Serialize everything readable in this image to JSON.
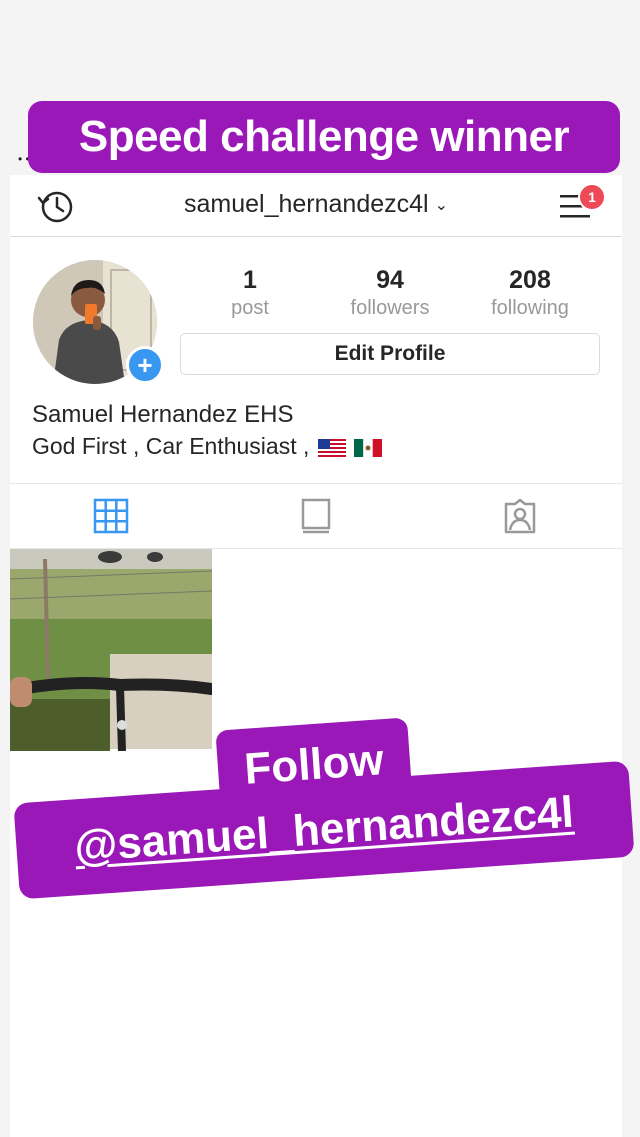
{
  "story_top_banner": "Speed challenge winner",
  "header": {
    "username": "samuel_hernandezc4l",
    "notification_count": "1"
  },
  "stats": [
    {
      "value": "1",
      "label": "post"
    },
    {
      "value": "94",
      "label": "followers"
    },
    {
      "value": "208",
      "label": "following"
    }
  ],
  "edit_profile_label": "Edit Profile",
  "profile": {
    "full_name": "Samuel Hernandez EHS",
    "bio": "God First , Car Enthusiast ,"
  },
  "follow_sticker": {
    "line1": "Follow",
    "line2": "@samuel_hernandezc4l"
  },
  "colors": {
    "sticker_purple": "#9b18b8",
    "accent_blue": "#3897f0",
    "badge_red": "#ed4956"
  },
  "icons": {
    "header_left": "history-icon",
    "header_right": "menu-icon",
    "tabs": [
      "grid-icon",
      "feed-icon",
      "tagged-icon"
    ]
  }
}
